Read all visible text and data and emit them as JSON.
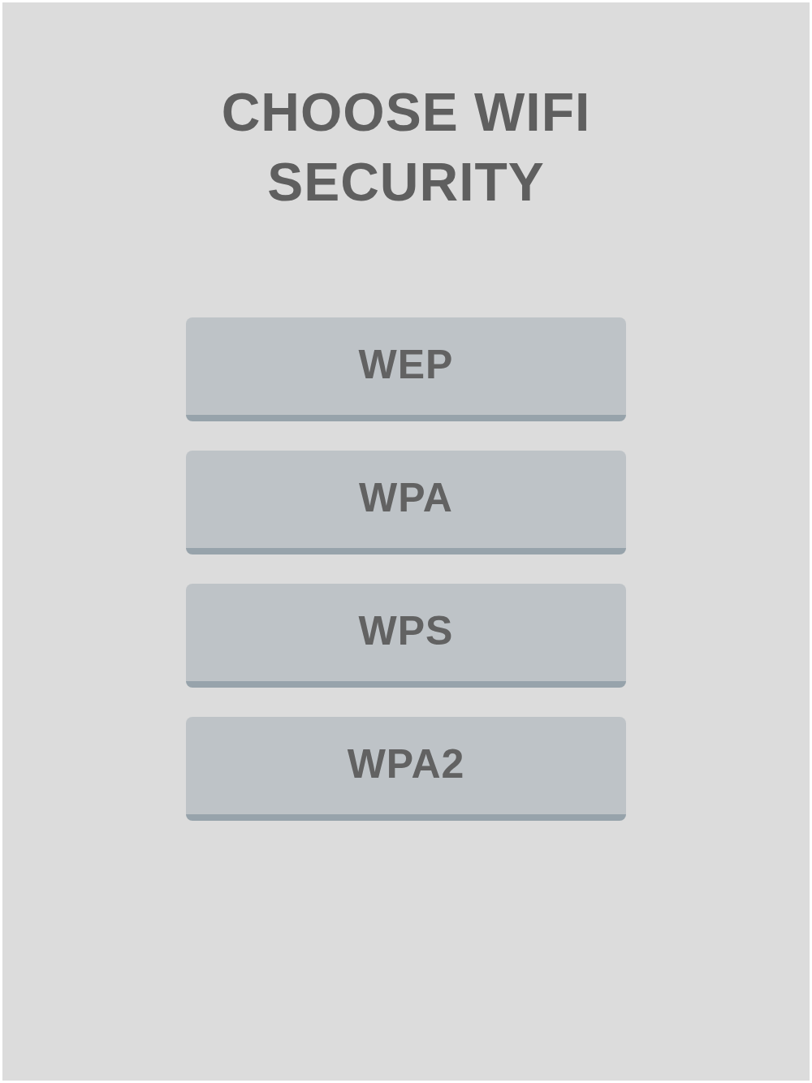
{
  "title": "CHOOSE WIFI SECURITY",
  "options": [
    {
      "label": "WEP"
    },
    {
      "label": "WPA"
    },
    {
      "label": "WPS"
    },
    {
      "label": "WPA2"
    }
  ]
}
